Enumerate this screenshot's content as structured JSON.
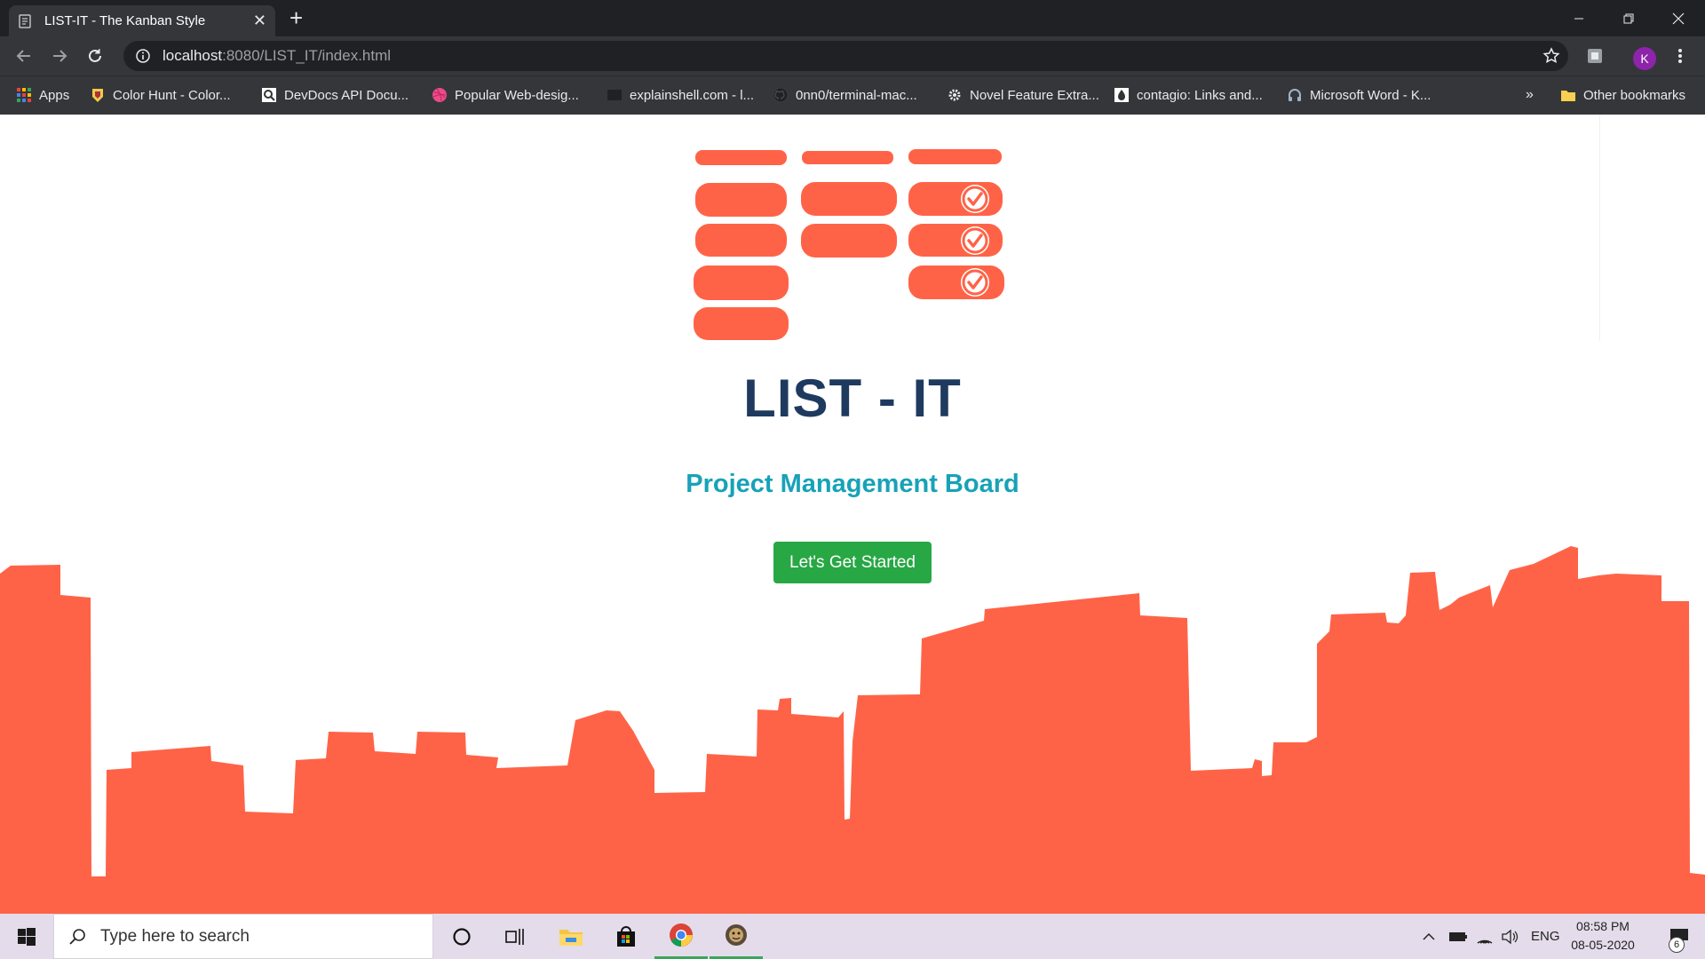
{
  "browser": {
    "tab_title": "LIST-IT - The Kanban Style",
    "url_host": "localhost",
    "url_path": ":8080/LIST_IT/index.html",
    "profile_initial": "K",
    "bookmarks": [
      {
        "label": "Apps",
        "icon": "apps-grid-icon"
      },
      {
        "label": "Color Hunt - Color...",
        "icon": "color-hunt-icon"
      },
      {
        "label": "DevDocs API Docu...",
        "icon": "devdocs-icon"
      },
      {
        "label": "Popular Web-desig...",
        "icon": "dribbble-icon"
      },
      {
        "label": "explainshell.com - l...",
        "icon": "explainshell-icon"
      },
      {
        "label": "0nn0/terminal-mac...",
        "icon": "github-icon"
      },
      {
        "label": "Novel Feature Extra...",
        "icon": "gear-icon"
      },
      {
        "label": "contagio: Links and...",
        "icon": "contagio-icon"
      },
      {
        "label": "Microsoft Word - K...",
        "icon": "headphones-icon"
      }
    ],
    "bookmarks_overflow": "»",
    "other_bookmarks": "Other bookmarks"
  },
  "page": {
    "title": "LIST - IT",
    "subtitle": "Project Management Board",
    "cta_label": "Let's Get Started",
    "accent_color": "#ff6347",
    "title_color": "#1f3a5f",
    "subtitle_color": "#17a2b8",
    "cta_color": "#28a745"
  },
  "taskbar": {
    "search_placeholder": "Type here to search",
    "language": "ENG",
    "time": "08:58 PM",
    "date": "08-05-2020",
    "notification_count": "6"
  }
}
